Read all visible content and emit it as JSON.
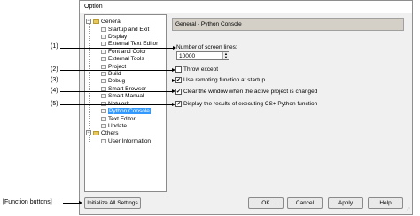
{
  "dialog": {
    "title": "Option"
  },
  "tree": {
    "items": [
      {
        "label": "General"
      },
      {
        "label": "Startup and Exit"
      },
      {
        "label": "Display"
      },
      {
        "label": "External Text Editor"
      },
      {
        "label": "Font and Color"
      },
      {
        "label": "External Tools"
      },
      {
        "label": "Project"
      },
      {
        "label": "Build"
      },
      {
        "label": "Debug"
      },
      {
        "label": "Smart Browser"
      },
      {
        "label": "Smart Manual"
      },
      {
        "label": "Network"
      },
      {
        "label": "Python Console"
      },
      {
        "label": "Text Editor"
      },
      {
        "label": "Update"
      },
      {
        "label": "Others"
      },
      {
        "label": "User Information"
      }
    ]
  },
  "panel": {
    "header": "General - Python Console",
    "screen_lines_label": "Number of screen lines:",
    "screen_lines_value": "10000",
    "options": [
      {
        "label": "Throw except",
        "checked": false
      },
      {
        "label": "Use remoting function at startup",
        "checked": true
      },
      {
        "label": "Clear the window when the active project is changed",
        "checked": true
      },
      {
        "label": "Display the results of executing CS+ Python function",
        "checked": true
      }
    ]
  },
  "buttons": {
    "initialize": "Initialize All Settings",
    "ok": "OK",
    "cancel": "Cancel",
    "apply": "Apply",
    "help": "Help"
  },
  "annotations": {
    "c1": "(1)",
    "c2": "(2)",
    "c3": "(3)",
    "c4": "(4)",
    "c5": "(5)",
    "function_buttons": "[Function buttons]"
  },
  "check_mark": "✔"
}
